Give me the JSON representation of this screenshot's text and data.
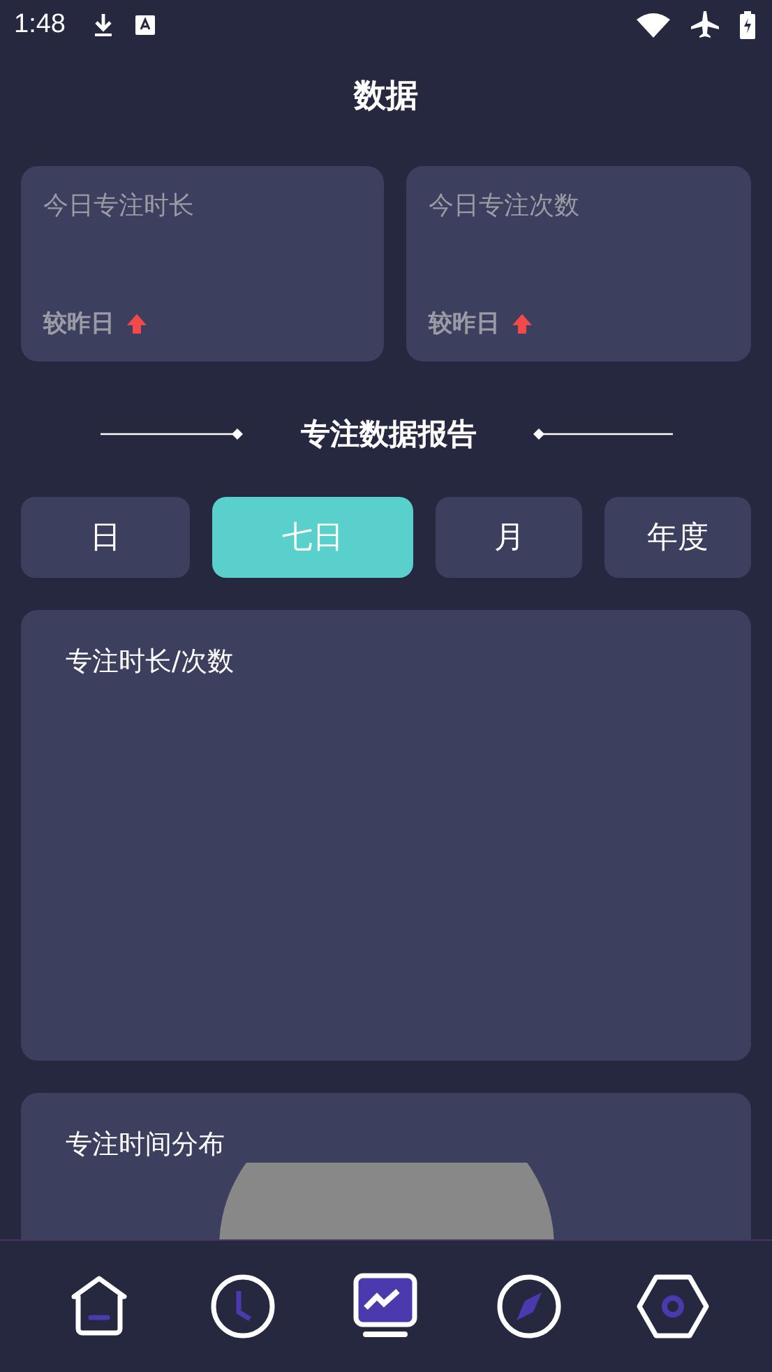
{
  "status_bar": {
    "time": "1:48"
  },
  "title": "数据",
  "stat_cards": [
    {
      "label": "今日专注时长",
      "compare": "较昨日",
      "increased": true
    },
    {
      "label": "今日专注次数",
      "compare": "较昨日",
      "increased": true
    }
  ],
  "section_title": "专注数据报告",
  "tabs": [
    {
      "label": "日",
      "selected": false
    },
    {
      "label": "七日",
      "selected": true
    },
    {
      "label": "月",
      "selected": false
    },
    {
      "label": "年度",
      "selected": false
    }
  ],
  "panels": [
    {
      "title": "专注时长/次数",
      "kind": "empty"
    },
    {
      "title": "专注时间分布",
      "kind": "pie"
    }
  ],
  "nav": [
    {
      "kind": "home",
      "selected": false
    },
    {
      "kind": "clock",
      "selected": false
    },
    {
      "kind": "stats",
      "selected": true
    },
    {
      "kind": "compass",
      "selected": false
    },
    {
      "kind": "settings",
      "selected": false
    }
  ]
}
